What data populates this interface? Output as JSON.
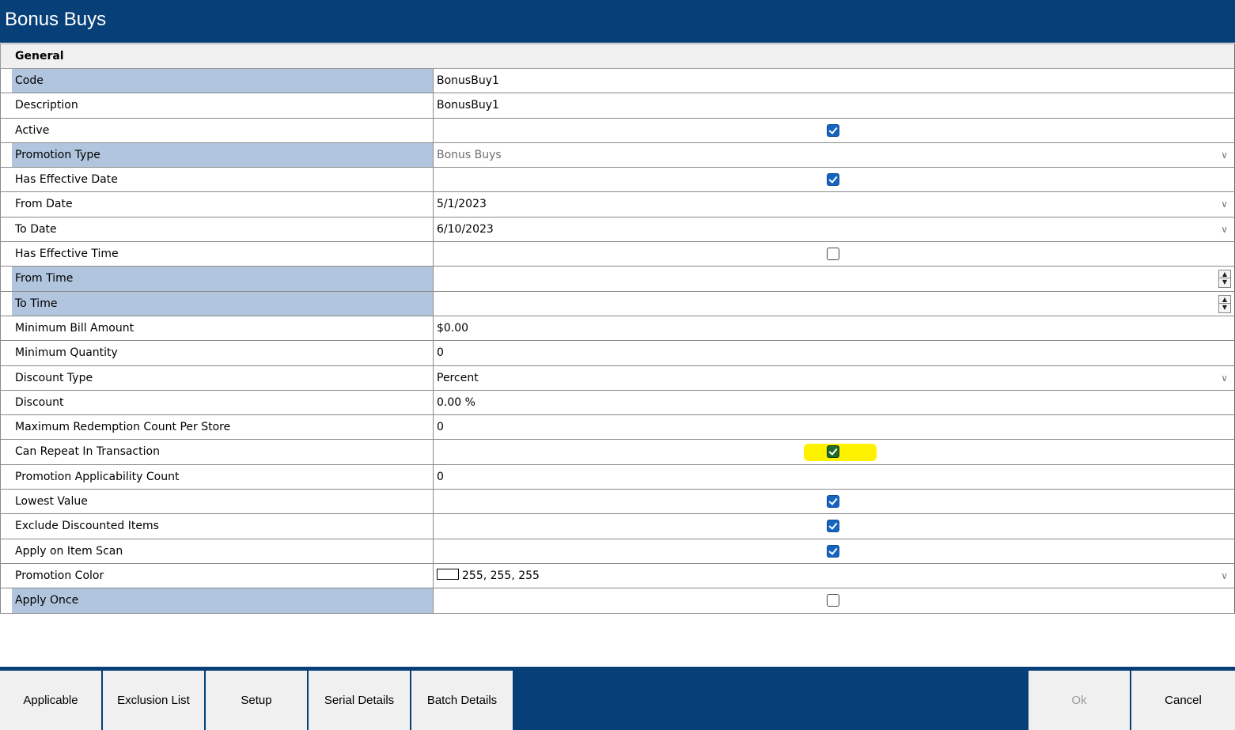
{
  "window": {
    "title": "Bonus Buys"
  },
  "category": "General",
  "properties": [
    {
      "label": "Code",
      "value": "BonusBuy1",
      "selected": true
    },
    {
      "label": "Description",
      "value": "BonusBuy1"
    },
    {
      "label": "Active",
      "checkbox": true
    },
    {
      "label": "Promotion Type",
      "value": "Bonus Buys",
      "dropdown": true,
      "disabled": true,
      "selected": true
    },
    {
      "label": "Has Effective Date",
      "checkbox": true
    },
    {
      "label": "From Date",
      "value": "5/1/2023",
      "dropdown": true
    },
    {
      "label": "To Date",
      "value": "6/10/2023",
      "dropdown": true
    },
    {
      "label": "Has Effective Time",
      "checkbox": false
    },
    {
      "label": "From Time",
      "value": "",
      "spinner": true,
      "selected": true
    },
    {
      "label": "To Time",
      "value": "",
      "spinner": true,
      "selected": true
    },
    {
      "label": "Minimum Bill Amount",
      "value": "$0.00"
    },
    {
      "label": "Minimum Quantity",
      "value": "0"
    },
    {
      "label": "Discount Type",
      "value": "Percent",
      "dropdown": true
    },
    {
      "label": "Discount",
      "value": "0.00 %"
    },
    {
      "label": "Maximum Redemption Count Per Store",
      "value": "0"
    },
    {
      "label": "Can Repeat In Transaction",
      "checkbox": true,
      "highlighted": true
    },
    {
      "label": "Promotion Applicability Count",
      "value": "0"
    },
    {
      "label": "Lowest Value",
      "checkbox": true
    },
    {
      "label": "Exclude Discounted Items",
      "checkbox": true
    },
    {
      "label": "Apply on Item Scan",
      "checkbox": true
    },
    {
      "label": "Promotion Color",
      "value": "255, 255, 255",
      "dropdown": true,
      "swatch": true
    },
    {
      "label": "Apply Once",
      "checkbox": false,
      "selected": true
    }
  ],
  "buttons": {
    "applicable": "Applicable",
    "exclusion_list": "Exclusion List",
    "setup": "Setup",
    "serial_details": "Serial Details",
    "batch_details": "Batch Details",
    "ok": "Ok",
    "cancel": "Cancel"
  },
  "colors": {
    "header": "#073f78",
    "selected_label": "#b1c5de",
    "checkbox": "#1565c0",
    "highlight": "#fff200"
  }
}
